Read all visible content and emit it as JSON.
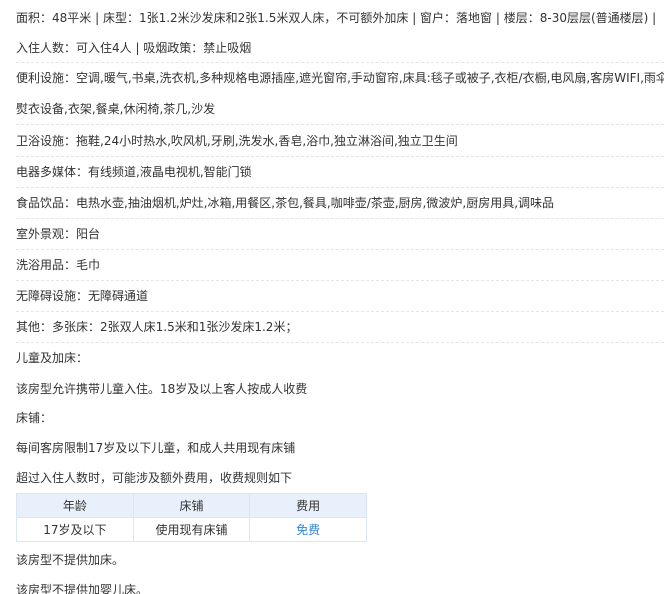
{
  "room_info": {
    "row1": "面积：48平米 | 床型：1张1.2米沙发床和2张1.5米双人床，不可额外加床 | 窗户：落地窗 | 楼层：8-30层层(普通楼层) |",
    "row2": "入住人数：可入住4人 | 吸烟政策：禁止吸烟",
    "amenities_line1": "便利设施：空调,暖气,书桌,洗衣机,多种规格电源插座,遮光窗帘,手动窗帘,床具:毯子或被子,衣柜/衣橱,电风扇,客房WIFI,雨伞,",
    "amenities_line2": "熨衣设备,衣架,餐桌,休闲椅,茶几,沙发",
    "bathroom": "卫浴设施：拖鞋,24小时热水,吹风机,牙刷,洗发水,香皂,浴巾,独立淋浴间,独立卫生间",
    "media": "电器多媒体：有线频道,液晶电视机,智能门锁",
    "food": "食品饮品：电热水壶,抽油烟机,炉灶,冰箱,用餐区,茶包,餐具,咖啡壶/茶壶,厨房,微波炉,厨房用具,调味品",
    "outdoor": "室外景观：阳台",
    "toiletries": "洗浴用品：毛巾",
    "accessibility": "无障碍设施：无障碍通道",
    "other": "其他：多张床：2张双人床1.5米和1张沙发床1.2米；",
    "children_heading": "儿童及加床：",
    "children_policy": "该房型允许携带儿童入住。18岁及以上客人按成人收费",
    "bedding_heading": "床铺：",
    "bedding_rule": "每间客房限制17岁及以下儿童，和成人共用现有床铺",
    "extra_fee_note": "超过入住人数时，可能涉及额外费用，收费规则如下",
    "fee_table": {
      "headers": [
        "年龄",
        "床铺",
        "费用"
      ],
      "rows": [
        {
          "age": "17岁及以下",
          "bed": "使用现有床铺",
          "fee": "免费"
        }
      ]
    },
    "no_extra_bed": "该房型不提供加床。",
    "no_crib": "该房型不提供加婴儿床。"
  },
  "colors": {
    "text": "#333333",
    "divider": "#e6e6e6",
    "table_header_bg": "#e8f1fb",
    "table_border": "#dbe6f2",
    "link": "#2f86d9"
  }
}
